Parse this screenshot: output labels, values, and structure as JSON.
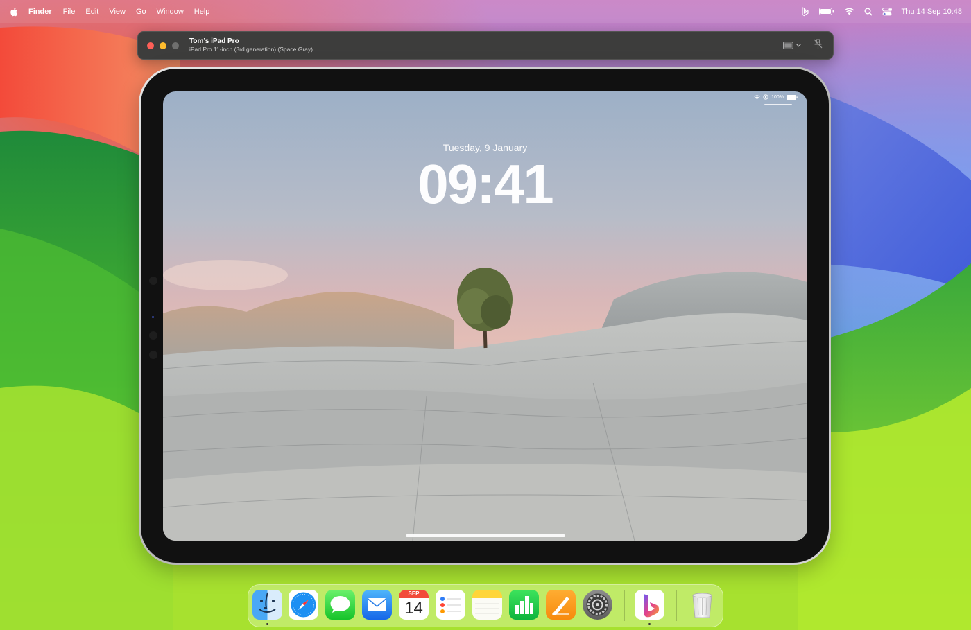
{
  "menubar": {
    "app_name": "Finder",
    "items": [
      "File",
      "Edit",
      "View",
      "Go",
      "Window",
      "Help"
    ],
    "clock": "Thu 14 Sep  10:48"
  },
  "window": {
    "title": "Tom’s iPad Pro",
    "subtitle": "iPad Pro 11-inch (3rd generation) (Space Gray)"
  },
  "ipad": {
    "battery": "100%",
    "date": "Tuesday, 9 January",
    "time": "09:41"
  },
  "dock": {
    "calendar_month": "SEP",
    "calendar_day": "14",
    "apps": [
      "finder",
      "safari",
      "messages",
      "mail",
      "calendar",
      "reminders",
      "notes",
      "numbers",
      "pages",
      "system-settings",
      "bing",
      "trash"
    ]
  },
  "colors": {
    "close": "#fe5f57",
    "minimize": "#febc2e",
    "window_bg": "#3d3d3c"
  }
}
